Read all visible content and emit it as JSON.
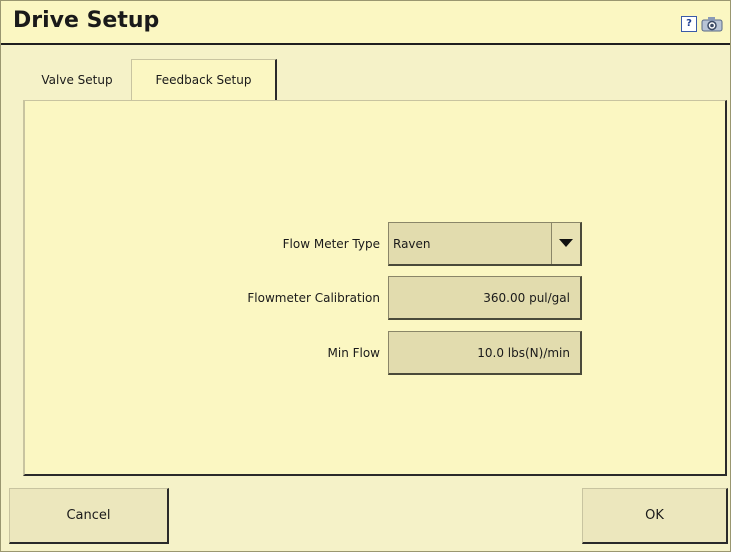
{
  "window": {
    "title": "Drive Setup",
    "help_icon_glyph": "?",
    "icons": [
      "help-icon",
      "camera-icon"
    ]
  },
  "tabs": [
    {
      "label": "Valve Setup",
      "active": false
    },
    {
      "label": "Feedback Setup",
      "active": true
    }
  ],
  "form": {
    "flow_meter_type": {
      "label": "Flow Meter Type",
      "value": "Raven"
    },
    "flowmeter_calibration": {
      "label": "Flowmeter Calibration",
      "value": "360.00 pul/gal"
    },
    "min_flow": {
      "label": "Min Flow",
      "value": "10.0 lbs(N)/min"
    }
  },
  "buttons": {
    "cancel": "Cancel",
    "ok": "OK"
  },
  "colors": {
    "background": "#f5f2c8",
    "panel": "#fbf7c2",
    "field": "#e2dcae"
  }
}
